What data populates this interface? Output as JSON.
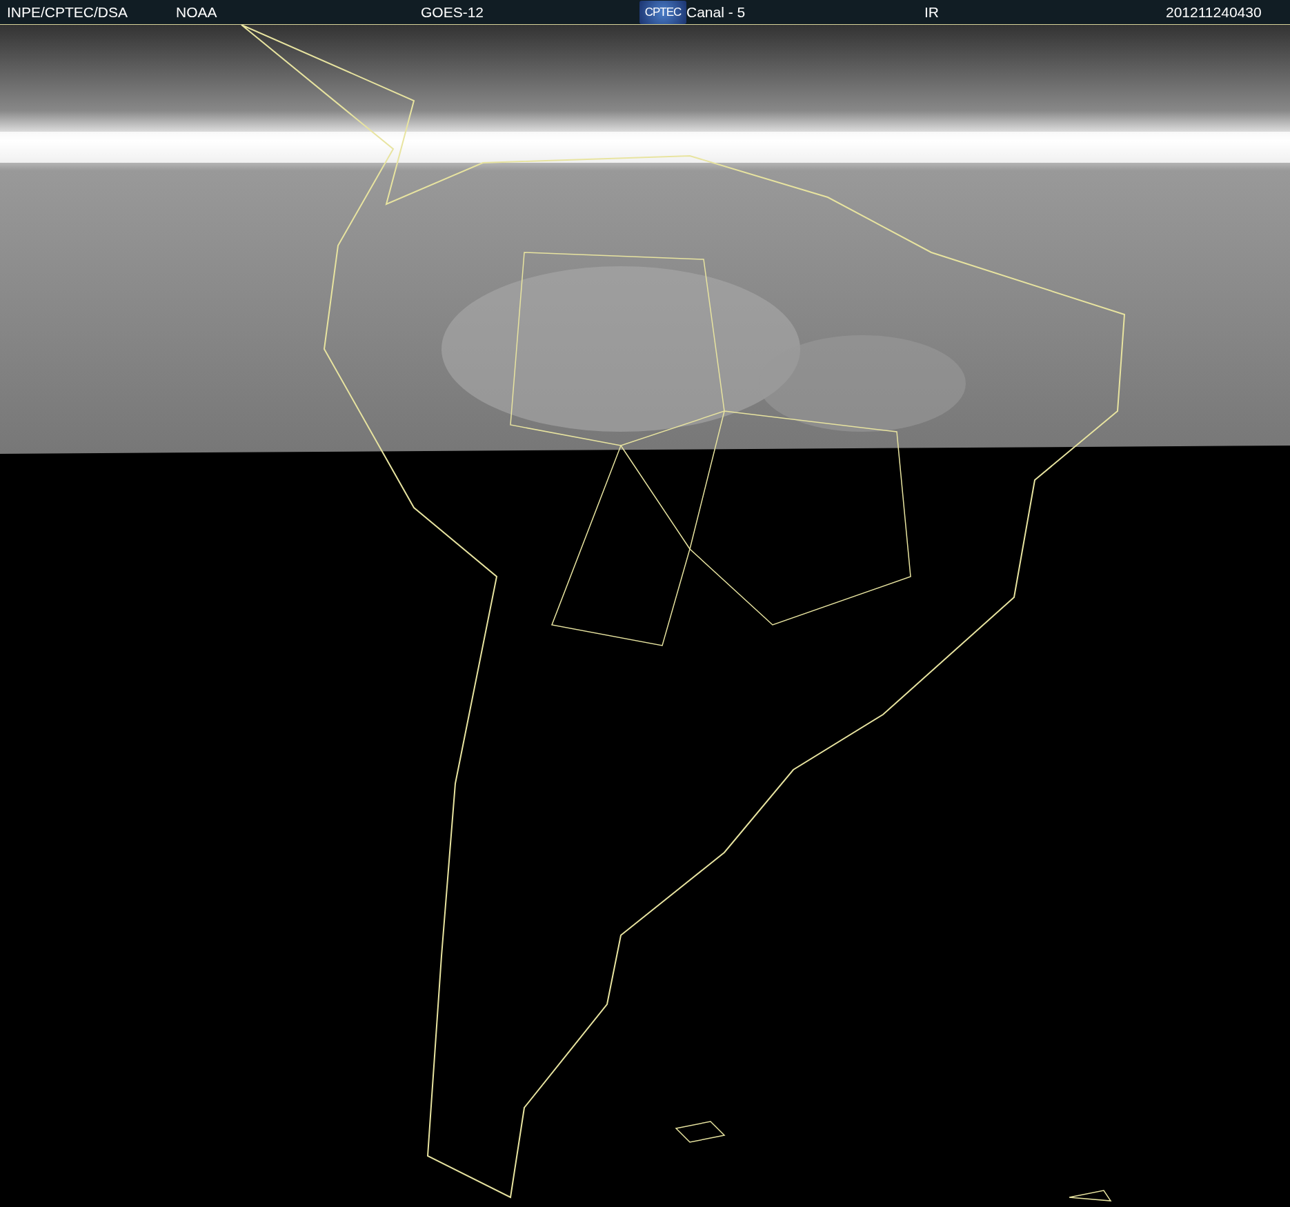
{
  "header": {
    "items": [
      {
        "kind": "text",
        "text": "INPE/CPTEC/DSA"
      },
      {
        "kind": "text",
        "text": "NOAA"
      },
      {
        "kind": "text",
        "text": "GOES-12"
      },
      {
        "kind": "logo",
        "text": "CPTEC"
      },
      {
        "kind": "text",
        "text": "Canal - 5"
      },
      {
        "kind": "text",
        "text": "IR"
      },
      {
        "kind": "text",
        "text": "201211240430"
      }
    ]
  }
}
